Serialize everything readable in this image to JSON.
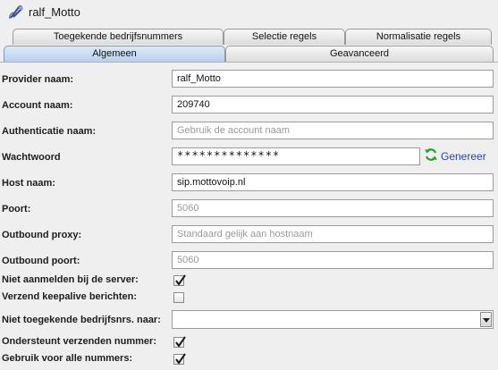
{
  "window": {
    "title": "ralf_Motto"
  },
  "tabs": {
    "row1": [
      "Toegekende bedrijfsnummers",
      "Selectie regels",
      "Normalisatie regels"
    ],
    "row2": [
      "Algemeen",
      "Geavanceerd"
    ],
    "selected": "Algemeen"
  },
  "form": {
    "provider_naam": {
      "label": "Provider naam:",
      "value": "ralf_Motto"
    },
    "account_naam": {
      "label": "Account naam:",
      "value": "209740"
    },
    "authenticatie_naam": {
      "label": "Authenticatie naam:",
      "placeholder": "Gebruik de account naam"
    },
    "wachtwoord": {
      "label": "Wachtwoord",
      "value": "**************"
    },
    "genereer": {
      "label": "Genereer",
      "icon": "refresh-icon"
    },
    "host_naam": {
      "label": "Host naam:",
      "value": "sip.mottovoip.nl"
    },
    "poort": {
      "label": "Poort:",
      "value": "5060"
    },
    "outbound_proxy": {
      "label": "Outbound proxy:",
      "placeholder": "Standaard gelijk aan hostnaam"
    },
    "outbound_poort": {
      "label": "Outbound poort:",
      "value": "5060"
    },
    "niet_aanmelden": {
      "label": "Niet aanmelden bij de server:",
      "checked": true
    },
    "verzend_keepalive": {
      "label": "Verzend keepalive berichten:",
      "checked": false
    },
    "niet_toegekende": {
      "label": "Niet toegekende bedrijfsnrs. naar:",
      "value": ""
    },
    "ondersteunt_verzenden": {
      "label": "Ondersteunt verzenden nummer:",
      "checked": true
    },
    "gebruik_alle": {
      "label": "Gebruik voor alle nummers:",
      "checked": true
    }
  },
  "colors": {
    "link": "#2442c8",
    "selected_tab": "#b9d0ee",
    "refresh_icon": "#2f9e2f"
  }
}
